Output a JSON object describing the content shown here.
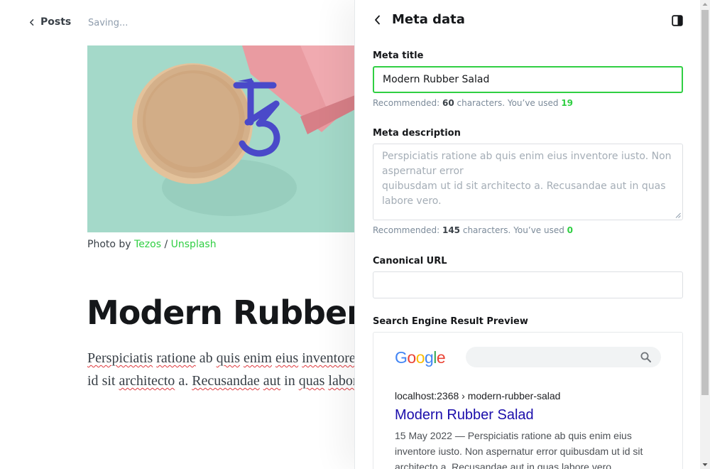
{
  "editor": {
    "back_label": "Posts",
    "status": "Saving...",
    "caption": {
      "prefix": "Photo by ",
      "author": "Tezos",
      "separator": " / ",
      "source": "Unsplash"
    },
    "post_title": "Modern Rubber Salad",
    "body_lines": [
      [
        "Perspiciatis",
        "ratione",
        "ab",
        "quis",
        "enim",
        "eius",
        "inventore"
      ],
      [
        "id",
        "sit",
        "architecto",
        "a.",
        "Recusandae",
        "aut",
        "in",
        "quas",
        "labore"
      ]
    ],
    "spelling_flagged": [
      "Perspiciatis",
      "ratione",
      "quis",
      "enim",
      "eius",
      "inventore",
      "architecto",
      "Recusandae",
      "aut",
      "quas",
      "labore"
    ]
  },
  "panel": {
    "title": "Meta data",
    "meta_title": {
      "label": "Meta title",
      "value": "Modern Rubber Salad",
      "hint_prefix": "Recommended: ",
      "recommended": "60",
      "hint_mid": " characters. You’ve used ",
      "used": "19"
    },
    "meta_description": {
      "label": "Meta description",
      "placeholder_lines": [
        "Perspiciatis ratione ab quis enim eius inventore iusto. Non",
        "aspernatur error",
        "quibusdam ut id sit architecto a. Recusandae aut in quas",
        "labore vero."
      ],
      "hint_prefix": "Recommended: ",
      "recommended": "145",
      "hint_mid": " characters. You’ve used ",
      "used": "0"
    },
    "canonical_url": {
      "label": "Canonical URL",
      "value": ""
    },
    "serp_preview": {
      "label": "Search Engine Result Preview",
      "logo_text": "Google",
      "url": "localhost:2368 › modern-rubber-salad",
      "title": "Modern Rubber Salad",
      "description_lines": [
        "15 May 2022 — Perspiciatis ratione ab quis enim eius",
        "inventore iusto. Non aspernatur error quibusdam ut id sit",
        "architecto a. Recusandae aut in quas labore vero."
      ]
    }
  },
  "colors": {
    "accent_green": "#30cf43",
    "serp_link": "#1a0dab",
    "google_blue": "#4285f4",
    "google_red": "#ea4335",
    "google_yellow": "#fbbc05",
    "google_green": "#34a853",
    "spell_underline": "#e0393e"
  },
  "icons": {
    "back_posts": "chevron-left-icon",
    "panel_back": "chevron-left-icon",
    "panel_toggle": "sidebar-toggle-icon",
    "serp_search": "magnifier-icon"
  }
}
